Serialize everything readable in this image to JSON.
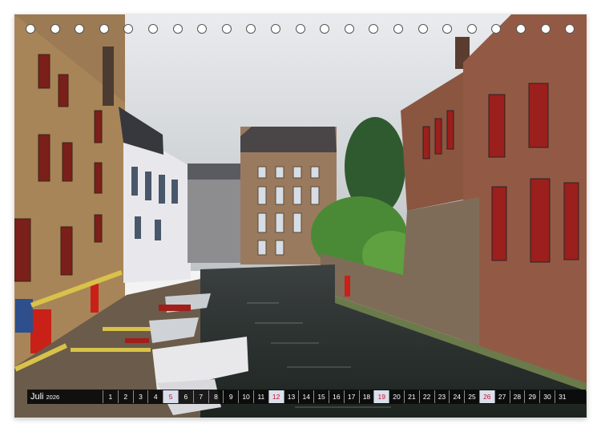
{
  "calendar": {
    "month": "Juli",
    "year": "2026",
    "days": [
      "1",
      "2",
      "3",
      "4",
      "5",
      "6",
      "7",
      "8",
      "9",
      "10",
      "11",
      "12",
      "13",
      "14",
      "15",
      "16",
      "17",
      "18",
      "19",
      "20",
      "21",
      "22",
      "23",
      "24",
      "25",
      "26",
      "27",
      "28",
      "29",
      "30",
      "31"
    ],
    "weekend_days": [
      "5",
      "12",
      "19",
      "26"
    ]
  },
  "colors": {
    "bar": "#0a0a0a",
    "weekend_text": "#c0122a",
    "weekend_bg": "#d9e0ec"
  }
}
